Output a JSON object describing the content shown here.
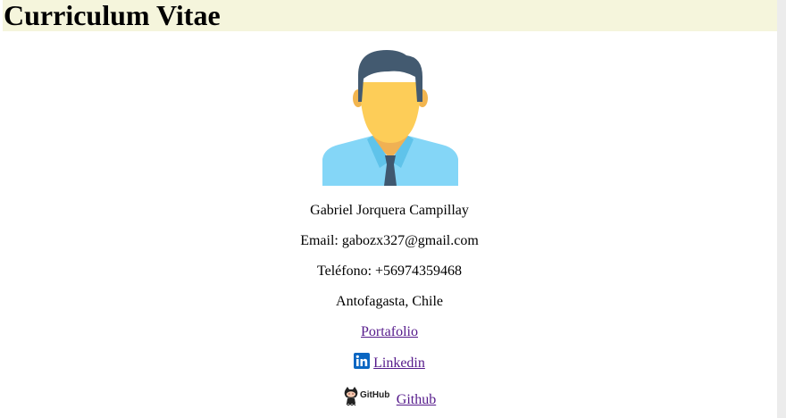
{
  "header": {
    "title": "Curriculum Vitae"
  },
  "profile": {
    "avatar_icon": "person-avatar-icon",
    "name": "Gabriel Jorquera Campillay",
    "email": "Email: gabozx327@gmail.com",
    "phone": "Teléfono: +56974359468",
    "location": "Antofagasta, Chile"
  },
  "links": {
    "portfolio_label": "Portafolio",
    "linkedin_icon": "linkedin-icon",
    "linkedin_label": "Linkedin",
    "github_icon": "github-icon",
    "github_logo_text": "GitHub",
    "github_label": "Github"
  },
  "colors": {
    "title_bg": "#f5f5dc",
    "link": "#551a8b",
    "linkedin_blue": "#0a66c2"
  }
}
